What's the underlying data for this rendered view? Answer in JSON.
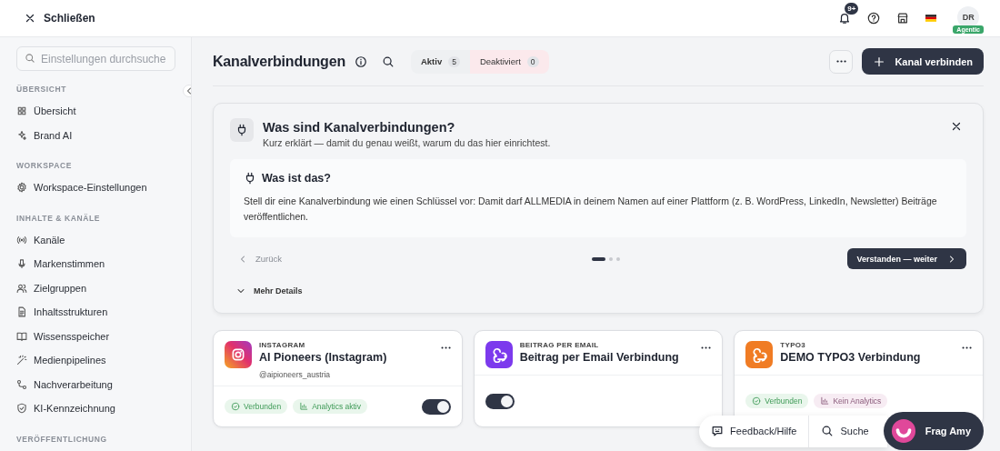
{
  "topbar": {
    "close_label": "Schließen",
    "notification_badge": "9+",
    "avatar_initials": "DR",
    "plan_badge": "Agentic"
  },
  "sidebar": {
    "search": {
      "placeholder": "Einstellungen durchsuche"
    },
    "sections": [
      {
        "heading": "ÜBERSICHT",
        "items": [
          "Übersicht",
          "Brand AI"
        ]
      },
      {
        "heading": "WORKSPACE",
        "items": [
          "Workspace-Einstellungen"
        ]
      },
      {
        "heading": "INHALTE & KANÄLE",
        "items": [
          "Kanäle",
          "Markenstimmen",
          "Zielgruppen",
          "Inhaltsstrukturen",
          "Wissensspeicher",
          "Medienpipelines",
          "Nachverarbeitung",
          "KI-Kennzeichnung"
        ]
      },
      {
        "heading": "VERÖFFENTLICHUNG"
      }
    ]
  },
  "header": {
    "title": "Kanalverbindungen",
    "tabs": [
      {
        "label": "Aktiv",
        "count": "5",
        "selected": true
      },
      {
        "label": "Deaktiviert",
        "count": "0",
        "selected": false
      }
    ],
    "primary_button": "Kanal verbinden"
  },
  "intro": {
    "title": "Was sind Kanalverbindungen?",
    "subtitle": "Kurz erklärt — damit du genau weißt, warum du das hier einrichtest.",
    "step_title": "Was ist das?",
    "step_text": "Stell dir eine Kanalverbindung wie einen Schlüssel vor: Damit darf ALLMEDIA in deinem Namen auf einer Plattform (z. B. WordPress, LinkedIn, Newsletter) Beiträge veröffentlichen.",
    "back": {
      "label": "Zurück",
      "disabled": true
    },
    "steps": [
      {
        "selected": true
      },
      {
        "selected": false
      },
      {
        "selected": false
      }
    ],
    "next_button": "Verstanden — weiter",
    "details_toggle": "Mehr Details"
  },
  "cards": [
    {
      "kind": "instagram",
      "eyebrow": "INSTAGRAM",
      "title": "AI Pioneers (Instagram)",
      "handle": "@aipioneers_austria",
      "badges": [
        {
          "kind": "positive",
          "label": "Verbunden"
        },
        {
          "kind": "positive",
          "label": "Analytics aktiv"
        }
      ],
      "on": true
    },
    {
      "kind": "webhook",
      "color": "#7c3aed",
      "eyebrow": "BEITRAG PER EMAIL",
      "title": "Beitrag per Email Verbindung",
      "on": true
    },
    {
      "kind": "webhook",
      "color": "#f07c24",
      "eyebrow": "TYPO3",
      "title": "DEMO TYPO3 Verbindung",
      "badges": [
        {
          "kind": "positive",
          "label": "Verbunden"
        },
        {
          "kind": "negative",
          "label": "Kein Analytics"
        }
      ]
    }
  ],
  "floating": {
    "feedback": "Feedback/Hilfe",
    "search": "Suche",
    "assistant": "Frag Amy"
  }
}
